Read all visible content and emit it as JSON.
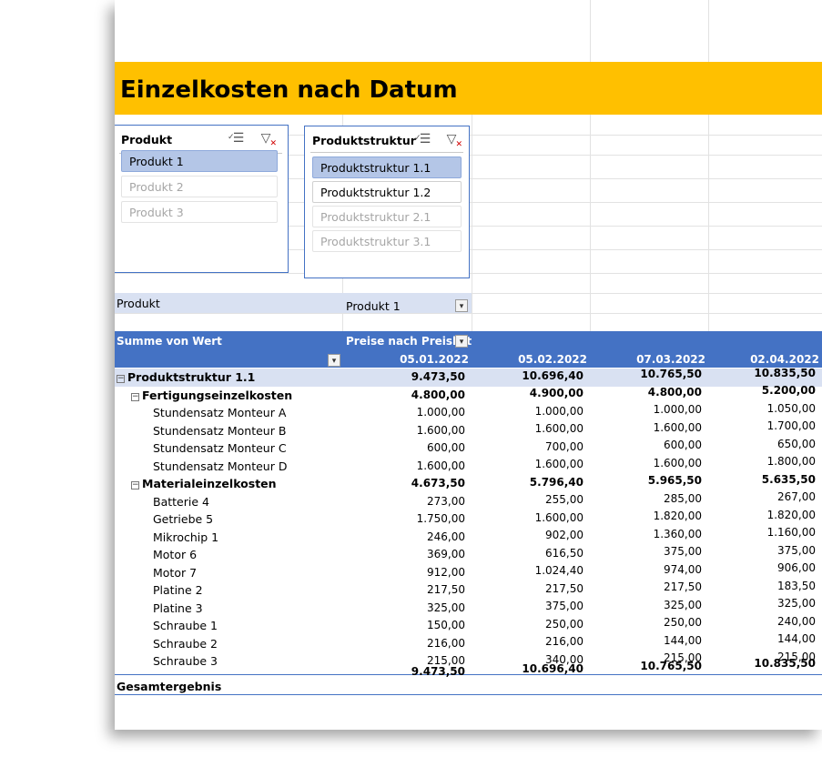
{
  "title": "Einzelkosten nach Datum",
  "colors": {
    "banner": "#ffc000",
    "header": "#4472c4",
    "band": "#d9e1f2",
    "selected": "#b4c6e7"
  },
  "slicer_produkt": {
    "header": "Produkt",
    "items": [
      {
        "label": "Produkt 1",
        "state": "selected"
      },
      {
        "label": "Produkt 2",
        "state": "disabled"
      },
      {
        "label": "Produkt 3",
        "state": "disabled"
      }
    ]
  },
  "slicer_struktur": {
    "header": "Produktstruktur",
    "items": [
      {
        "label": "Produktstruktur 1.1",
        "state": "selected"
      },
      {
        "label": "Produktstruktur 1.2",
        "state": "normal"
      },
      {
        "label": "Produktstruktur 2.1",
        "state": "disabled"
      },
      {
        "label": "Produktstruktur 3.1",
        "state": "disabled"
      }
    ]
  },
  "filter": {
    "label": "Produkt",
    "value": "Produkt 1"
  },
  "pivot": {
    "value_header": "Summe von Wert",
    "column_field": "Preise nach Preislist",
    "dates": [
      "05.01.2022",
      "05.02.2022",
      "07.03.2022",
      "02.04.2022"
    ],
    "rows": [
      {
        "label": "Produktstruktur 1.1",
        "level": 0,
        "expand": true,
        "values": [
          "9.473,50",
          "10.696,40",
          "10.765,50",
          "10.835,50"
        ]
      },
      {
        "label": "Fertigungseinzelkosten",
        "level": 1,
        "expand": true,
        "values": [
          "4.800,00",
          "4.900,00",
          "4.800,00",
          "5.200,00"
        ]
      },
      {
        "label": "Stundensatz Monteur A",
        "level": 2,
        "values": [
          "1.000,00",
          "1.000,00",
          "1.000,00",
          "1.050,00"
        ]
      },
      {
        "label": "Stundensatz Monteur B",
        "level": 2,
        "values": [
          "1.600,00",
          "1.600,00",
          "1.600,00",
          "1.700,00"
        ]
      },
      {
        "label": "Stundensatz Monteur C",
        "level": 2,
        "values": [
          "600,00",
          "700,00",
          "600,00",
          "650,00"
        ]
      },
      {
        "label": "Stundensatz Monteur D",
        "level": 2,
        "values": [
          "1.600,00",
          "1.600,00",
          "1.600,00",
          "1.800,00"
        ]
      },
      {
        "label": "Materialeinzelkosten",
        "level": 1,
        "expand": true,
        "values": [
          "4.673,50",
          "5.796,40",
          "5.965,50",
          "5.635,50"
        ]
      },
      {
        "label": "Batterie 4",
        "level": 2,
        "values": [
          "273,00",
          "255,00",
          "285,00",
          "267,00"
        ]
      },
      {
        "label": "Getriebe 5",
        "level": 2,
        "values": [
          "1.750,00",
          "1.600,00",
          "1.820,00",
          "1.820,00"
        ]
      },
      {
        "label": "Mikrochip 1",
        "level": 2,
        "values": [
          "246,00",
          "902,00",
          "1.360,00",
          "1.160,00"
        ]
      },
      {
        "label": "Motor 6",
        "level": 2,
        "values": [
          "369,00",
          "616,50",
          "375,00",
          "375,00"
        ]
      },
      {
        "label": "Motor 7",
        "level": 2,
        "values": [
          "912,00",
          "1.024,40",
          "974,00",
          "906,00"
        ]
      },
      {
        "label": "Platine 2",
        "level": 2,
        "values": [
          "217,50",
          "217,50",
          "217,50",
          "183,50"
        ]
      },
      {
        "label": "Platine 3",
        "level": 2,
        "values": [
          "325,00",
          "375,00",
          "325,00",
          "325,00"
        ]
      },
      {
        "label": "Schraube 1",
        "level": 2,
        "values": [
          "150,00",
          "250,00",
          "250,00",
          "240,00"
        ]
      },
      {
        "label": "Schraube 2",
        "level": 2,
        "values": [
          "216,00",
          "216,00",
          "144,00",
          "144,00"
        ]
      },
      {
        "label": "Schraube 3",
        "level": 2,
        "values": [
          "215,00",
          "340,00",
          "215,00",
          "215,00"
        ]
      }
    ],
    "grand_total": {
      "label": "Gesamtergebnis",
      "values": [
        "9.473,50",
        "10.696,40",
        "10.765,50",
        "10.835,50"
      ]
    }
  }
}
